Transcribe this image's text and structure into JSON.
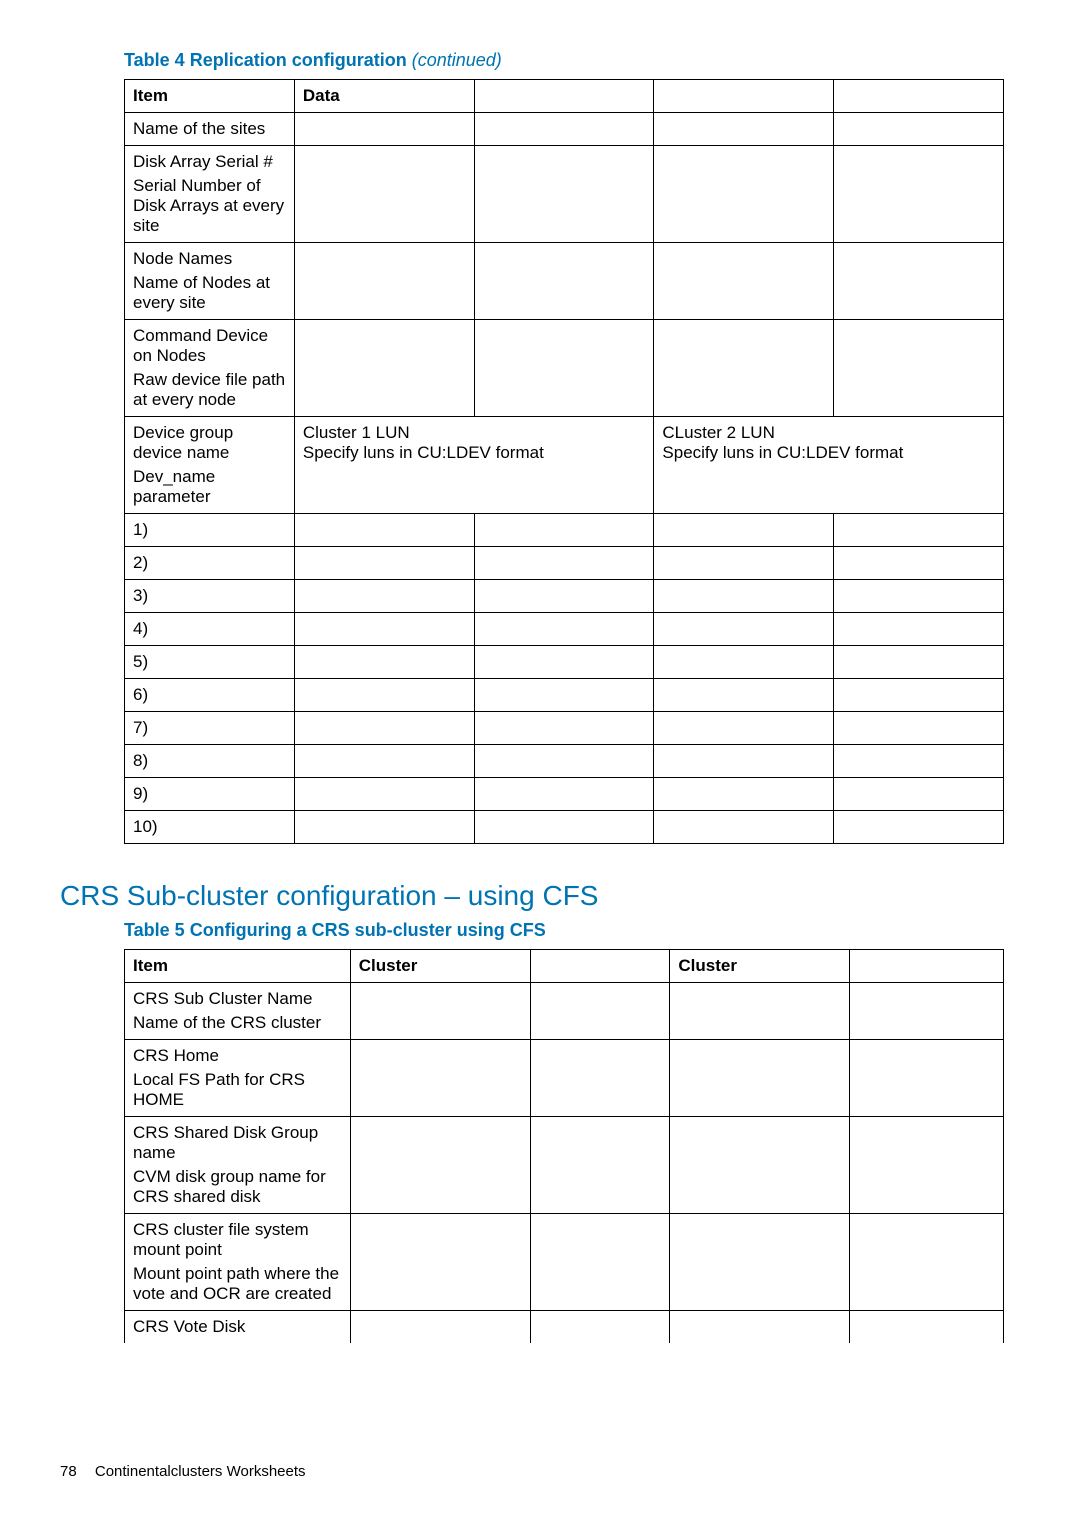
{
  "table4": {
    "caption_prefix": "Table 4 Replication configuration ",
    "caption_suffix": "(continued)",
    "header": {
      "item": "Item",
      "data": "Data"
    },
    "rows": {
      "r1": {
        "title": "Name of the sites",
        "sub": ""
      },
      "r2": {
        "title": "Disk Array Serial #",
        "sub": "Serial Number of Disk Arrays at every site"
      },
      "r3": {
        "title": "Node Names",
        "sub": "Name of Nodes at every site"
      },
      "r4": {
        "title": "Command Device on Nodes",
        "sub": "Raw device file path at every node"
      },
      "r5": {
        "title": "Device group device name",
        "sub": "Dev_name parameter",
        "cluster1_line1": "Cluster 1 LUN",
        "cluster1_line2": "Specify luns in CU:LDEV format",
        "cluster2_line1": "CLuster 2 LUN",
        "cluster2_line2": "Specify luns in CU:LDEV format"
      },
      "n1": "1)",
      "n2": "2)",
      "n3": "3)",
      "n4": "4)",
      "n5": "5)",
      "n6": "6)",
      "n7": "7)",
      "n8": "8)",
      "n9": "9)",
      "n10": "10)"
    }
  },
  "section_heading": "CRS Sub-cluster configuration – using CFS",
  "table5": {
    "caption": "Table 5 Configuring a CRS sub-cluster using CFS",
    "header": {
      "item": "Item",
      "cluster": "Cluster"
    },
    "rows": {
      "r1": {
        "title": "CRS Sub Cluster Name",
        "sub": "Name of the CRS cluster"
      },
      "r2": {
        "title": "CRS Home",
        "sub": "Local FS Path for CRS HOME"
      },
      "r3": {
        "title": "CRS Shared Disk Group name",
        "sub": "CVM disk group name for CRS shared disk"
      },
      "r4": {
        "title": "CRS cluster file system mount point",
        "sub": "Mount point path where the vote and OCR are created"
      },
      "r5": {
        "title": "CRS Vote Disk",
        "sub": ""
      }
    }
  },
  "footer": {
    "page_number": "78",
    "section": "Continentalclusters Worksheets"
  }
}
